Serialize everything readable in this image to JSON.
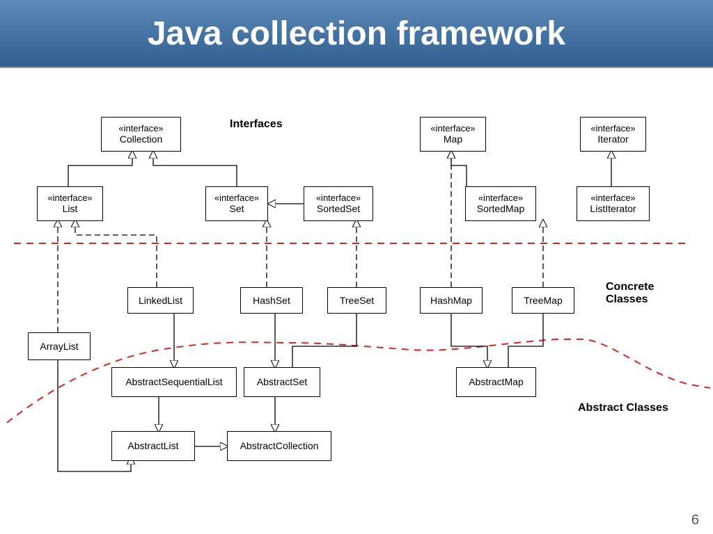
{
  "title": "Java collection framework",
  "page_number": "6",
  "section_labels": {
    "interfaces": "Interfaces",
    "concrete": "Concrete Classes",
    "abstract": "Abstract Classes"
  },
  "boxes": {
    "collection": {
      "stereotype": "«interface»",
      "name": "Collection"
    },
    "map": {
      "stereotype": "«interface»",
      "name": "Map"
    },
    "iterator": {
      "stereotype": "«interface»",
      "name": "Iterator"
    },
    "list": {
      "stereotype": "«interface»",
      "name": "List"
    },
    "set": {
      "stereotype": "«interface»",
      "name": "Set"
    },
    "sortedset": {
      "stereotype": "«interface»",
      "name": "SortedSet"
    },
    "sortedmap": {
      "stereotype": "«interface»",
      "name": "SortedMap"
    },
    "listiterator": {
      "stereotype": "«interface»",
      "name": "ListIterator"
    },
    "linkedlist": {
      "name": "LinkedList"
    },
    "hashset": {
      "name": "HashSet"
    },
    "treeset": {
      "name": "TreeSet"
    },
    "hashmap": {
      "name": "HashMap"
    },
    "treemap": {
      "name": "TreeMap"
    },
    "arraylist": {
      "name": "ArrayList"
    },
    "abstractsequential": {
      "name": "AbstractSequentialList"
    },
    "abstractset": {
      "name": "AbstractSet"
    },
    "abstractmap": {
      "name": "AbstractMap"
    },
    "abstractlist": {
      "name": "AbstractList"
    },
    "abstractcollection": {
      "name": "AbstractCollection"
    }
  }
}
